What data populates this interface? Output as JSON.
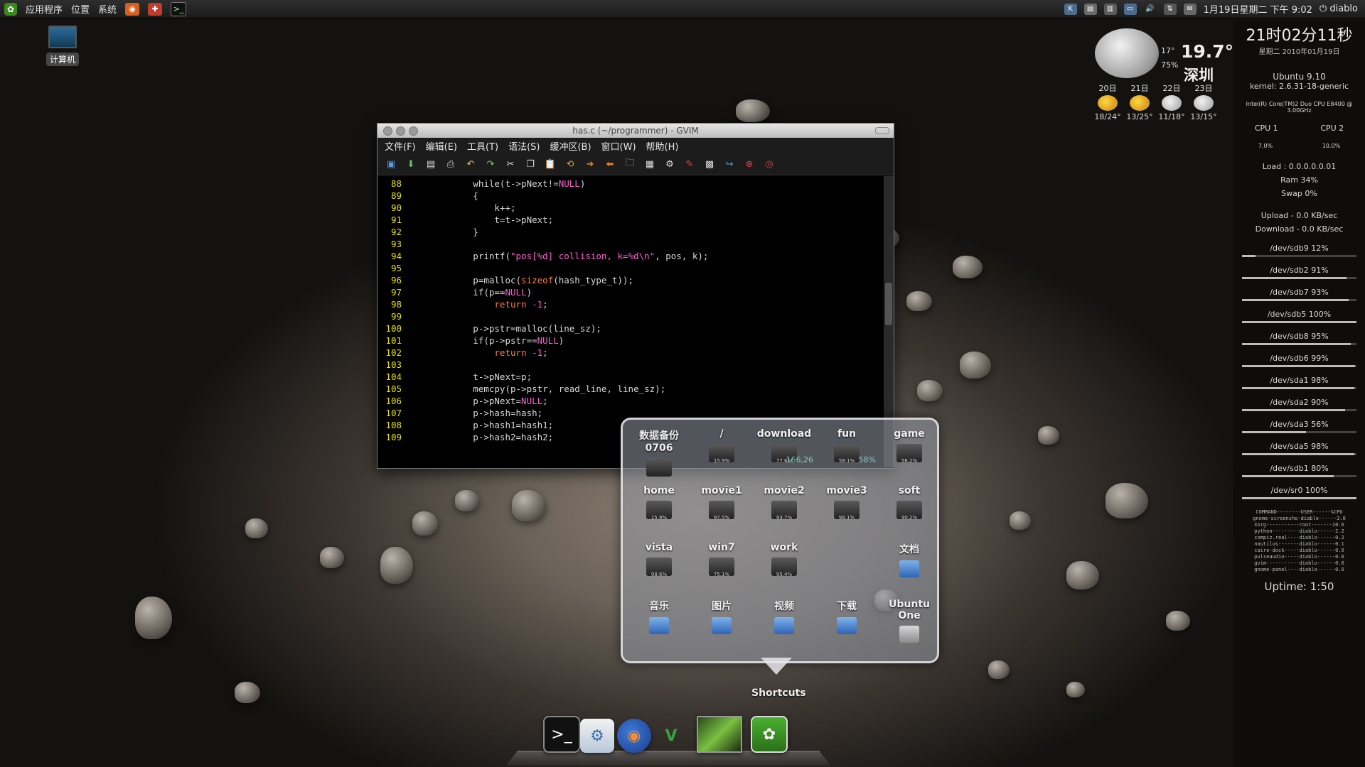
{
  "top_panel": {
    "menus": [
      "应用程序",
      "位置",
      "系统"
    ],
    "datetime": "1月19日星期二 下午 9:02",
    "user": "diablo"
  },
  "desktop": {
    "computer_label": "计算机"
  },
  "weather": {
    "current_small": "17°",
    "current_big": "19.7°",
    "humidity": "75%",
    "city": "深圳",
    "forecast": [
      {
        "day": "20日",
        "temp": "18/24°",
        "icon": "sun-cloud-icon"
      },
      {
        "day": "21日",
        "temp": "13/25°",
        "icon": "sun-cloud-icon"
      },
      {
        "day": "22日",
        "temp": "11/18°",
        "icon": "cloud-icon"
      },
      {
        "day": "23日",
        "temp": "13/15°",
        "icon": "cloud-icon"
      }
    ]
  },
  "sysinfo": {
    "clock": "21时02分11秒",
    "date": "星期二 2010年01月19日",
    "os": "Ubuntu 9.10",
    "kernel": "kernel: 2.6.31-18-generic",
    "cpu_model": "Intel(R) Core(TM)2 Duo CPU    E8400 @ 3.00GHz",
    "cpu1_label": "CPU 1",
    "cpu2_label": "CPU 2",
    "cpu1_value": "7.0%",
    "cpu2_value": "10.0%",
    "load": "Load : 0.0.0.0.0.01",
    "ram": "Ram 34%",
    "swap": "Swap 0%",
    "upload": "Upload - 0.0 KB/sec",
    "download": "Download - 0.0 KB/sec",
    "devices": [
      {
        "label": "/dev/sdb9 12%",
        "usage": 0.12
      },
      {
        "label": "/dev/sdb2 91%",
        "usage": 0.91
      },
      {
        "label": "/dev/sdb7 93%",
        "usage": 0.93
      },
      {
        "label": "/dev/sdb5 100%",
        "usage": 1.0
      },
      {
        "label": "/dev/sdb8 95%",
        "usage": 0.95
      },
      {
        "label": "/dev/sdb6 99%",
        "usage": 0.99
      },
      {
        "label": "/dev/sda1 98%",
        "usage": 0.98
      },
      {
        "label": "/dev/sda2 90%",
        "usage": 0.9
      },
      {
        "label": "/dev/sda3 56%",
        "usage": 0.56
      },
      {
        "label": "/dev/sda5 98%",
        "usage": 0.98
      },
      {
        "label": "/dev/sdb1 80%",
        "usage": 0.8
      },
      {
        "label": "/dev/sr0 100%",
        "usage": 1.0
      }
    ],
    "processes": [
      "COMMAND--------USER------%CPU",
      "gnome-screensho-diablo------3.0",
      "Xorg-----------root-------10.6",
      "python---------diablo------2.2",
      "compiz.real----diablo------0.2",
      "nautilus-------diablo------0.1",
      "cairo-dock-----diablo------0.0",
      "pulseaudio-----diablo------0.0",
      "gvim-----------diablo------0.0",
      "gnome-panel----diablo------0.0"
    ],
    "uptime": "Uptime: 1:50"
  },
  "gvim": {
    "title": "has.c (~/programmer) - GVIM",
    "menus": [
      "文件(F)",
      "编辑(E)",
      "工具(T)",
      "语法(S)",
      "缓冲区(B)",
      "窗口(W)",
      "帮助(H)"
    ],
    "lines": [
      {
        "n": "88",
        "segments": [
          {
            "t": "            while(t->pNext!=",
            "c": ""
          },
          {
            "t": "NULL",
            "c": "null"
          },
          {
            "t": ")",
            "c": ""
          }
        ]
      },
      {
        "n": "89",
        "segments": [
          {
            "t": "            {",
            "c": ""
          }
        ]
      },
      {
        "n": "90",
        "segments": [
          {
            "t": "                k++;",
            "c": ""
          }
        ]
      },
      {
        "n": "91",
        "segments": [
          {
            "t": "                t=t->pNext;",
            "c": ""
          }
        ]
      },
      {
        "n": "92",
        "segments": [
          {
            "t": "            }",
            "c": ""
          }
        ]
      },
      {
        "n": "93",
        "segments": [
          {
            "t": "",
            "c": ""
          }
        ]
      },
      {
        "n": "94",
        "segments": [
          {
            "t": "            printf(",
            "c": ""
          },
          {
            "t": "\"pos[%d] collision, k=%d\\n\"",
            "c": "str"
          },
          {
            "t": ", pos, k);",
            "c": ""
          }
        ]
      },
      {
        "n": "95",
        "segments": [
          {
            "t": "",
            "c": ""
          }
        ]
      },
      {
        "n": "96",
        "segments": [
          {
            "t": "            p=malloc(",
            "c": ""
          },
          {
            "t": "sizeof",
            "c": "kw"
          },
          {
            "t": "(hash_type_t));",
            "c": ""
          }
        ]
      },
      {
        "n": "97",
        "segments": [
          {
            "t": "            if(p==",
            "c": ""
          },
          {
            "t": "NULL",
            "c": "null"
          },
          {
            "t": ")",
            "c": ""
          }
        ]
      },
      {
        "n": "98",
        "segments": [
          {
            "t": "                return ",
            "c": "kw"
          },
          {
            "t": "-1",
            "c": "str"
          },
          {
            "t": ";",
            "c": ""
          }
        ]
      },
      {
        "n": "99",
        "segments": [
          {
            "t": "",
            "c": ""
          }
        ]
      },
      {
        "n": "100",
        "segments": [
          {
            "t": "            p->pstr=malloc(line_sz);",
            "c": ""
          }
        ]
      },
      {
        "n": "101",
        "segments": [
          {
            "t": "            if(p->pstr==",
            "c": ""
          },
          {
            "t": "NULL",
            "c": "null"
          },
          {
            "t": ")",
            "c": ""
          }
        ]
      },
      {
        "n": "102",
        "segments": [
          {
            "t": "                return ",
            "c": "kw"
          },
          {
            "t": "-1",
            "c": "str"
          },
          {
            "t": ";",
            "c": ""
          }
        ]
      },
      {
        "n": "103",
        "segments": [
          {
            "t": "",
            "c": ""
          }
        ]
      },
      {
        "n": "104",
        "segments": [
          {
            "t": "            t->pNext=p;",
            "c": ""
          }
        ]
      },
      {
        "n": "105",
        "segments": [
          {
            "t": "            memcpy(p->pstr, read_line, line_sz);",
            "c": ""
          }
        ]
      },
      {
        "n": "106",
        "segments": [
          {
            "t": "            p->pNext=",
            "c": ""
          },
          {
            "t": "NULL",
            "c": "null"
          },
          {
            "t": ";",
            "c": ""
          }
        ]
      },
      {
        "n": "107",
        "segments": [
          {
            "t": "            p->hash=hash;",
            "c": ""
          }
        ]
      },
      {
        "n": "108",
        "segments": [
          {
            "t": "            p->hash1=hash1;",
            "c": ""
          }
        ]
      },
      {
        "n": "109",
        "segments": [
          {
            "t": "            p->hash2=hash2;",
            "c": ""
          }
        ]
      }
    ]
  },
  "stack": {
    "items": [
      {
        "name": "数据备份0706",
        "kind": "drive",
        "pct": ""
      },
      {
        "name": "/",
        "kind": "drive",
        "pct": "15.9%"
      },
      {
        "name": "download",
        "kind": "drive",
        "pct": "77.6%",
        "hint": "166,26"
      },
      {
        "name": "fun",
        "kind": "drive",
        "pct": "58.1%",
        "hint": "58%"
      },
      {
        "name": "game",
        "kind": "drive",
        "pct": "56.2%"
      },
      {
        "name": "home",
        "kind": "drive",
        "pct": "15.9%"
      },
      {
        "name": "movie1",
        "kind": "drive",
        "pct": "97.5%"
      },
      {
        "name": "movie2",
        "kind": "drive",
        "pct": "93.7%"
      },
      {
        "name": "movie3",
        "kind": "drive",
        "pct": "98.1%"
      },
      {
        "name": "soft",
        "kind": "drive",
        "pct": "90.2%"
      },
      {
        "name": "vista",
        "kind": "drive",
        "pct": "98.6%"
      },
      {
        "name": "win7",
        "kind": "drive",
        "pct": "75.1%"
      },
      {
        "name": "work",
        "kind": "drive",
        "pct": "95.4%"
      },
      {
        "name": "",
        "kind": "empty",
        "pct": ""
      },
      {
        "name": "文档",
        "kind": "folder",
        "pct": ""
      },
      {
        "name": "音乐",
        "kind": "folder",
        "pct": ""
      },
      {
        "name": "图片",
        "kind": "folder",
        "pct": ""
      },
      {
        "name": "视频",
        "kind": "folder",
        "pct": ""
      },
      {
        "name": "下载",
        "kind": "folder",
        "pct": ""
      },
      {
        "name": "Ubuntu One",
        "kind": "folder-grey",
        "pct": ""
      }
    ]
  },
  "dock": {
    "label": "Shortcuts",
    "items": [
      "terminal-icon",
      "settings-icon",
      "firefox-icon",
      "vim-icon",
      "image-viewer-icon",
      "gnome-foot-icon"
    ]
  }
}
